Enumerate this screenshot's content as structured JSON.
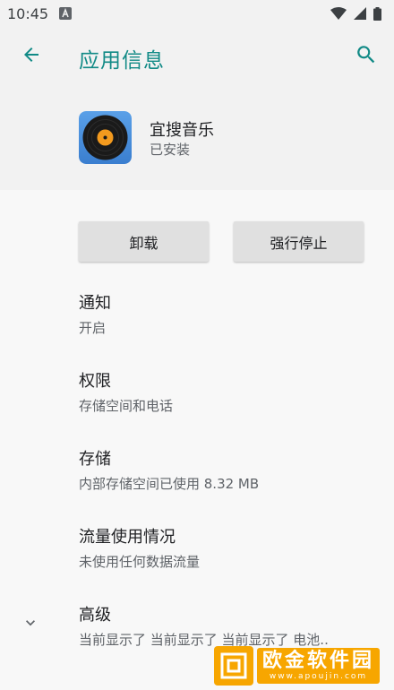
{
  "status_bar": {
    "time": "10:45"
  },
  "app_bar": {
    "title": "应用信息"
  },
  "app": {
    "name": "宜搜音乐",
    "status": "已安装"
  },
  "buttons": {
    "uninstall": "卸载",
    "force_stop": "强行停止"
  },
  "prefs": [
    {
      "title": "通知",
      "summary": "开启"
    },
    {
      "title": "权限",
      "summary": "存储空间和电话"
    },
    {
      "title": "存储",
      "summary": "内部存储空间已使用 8.32 MB"
    },
    {
      "title": "流量使用情况",
      "summary": "未使用任何数据流量"
    },
    {
      "title": "高级",
      "summary": "当前显示了 当前显示了 当前显示了 电池.."
    }
  ],
  "watermark": {
    "main": "欧金软件园",
    "sub": "www.apoujin.com"
  },
  "colors": {
    "accent": "#118a86",
    "background": "#f2f2f2",
    "content_background": "#f8f8f8",
    "button": "#e0e0e0"
  }
}
